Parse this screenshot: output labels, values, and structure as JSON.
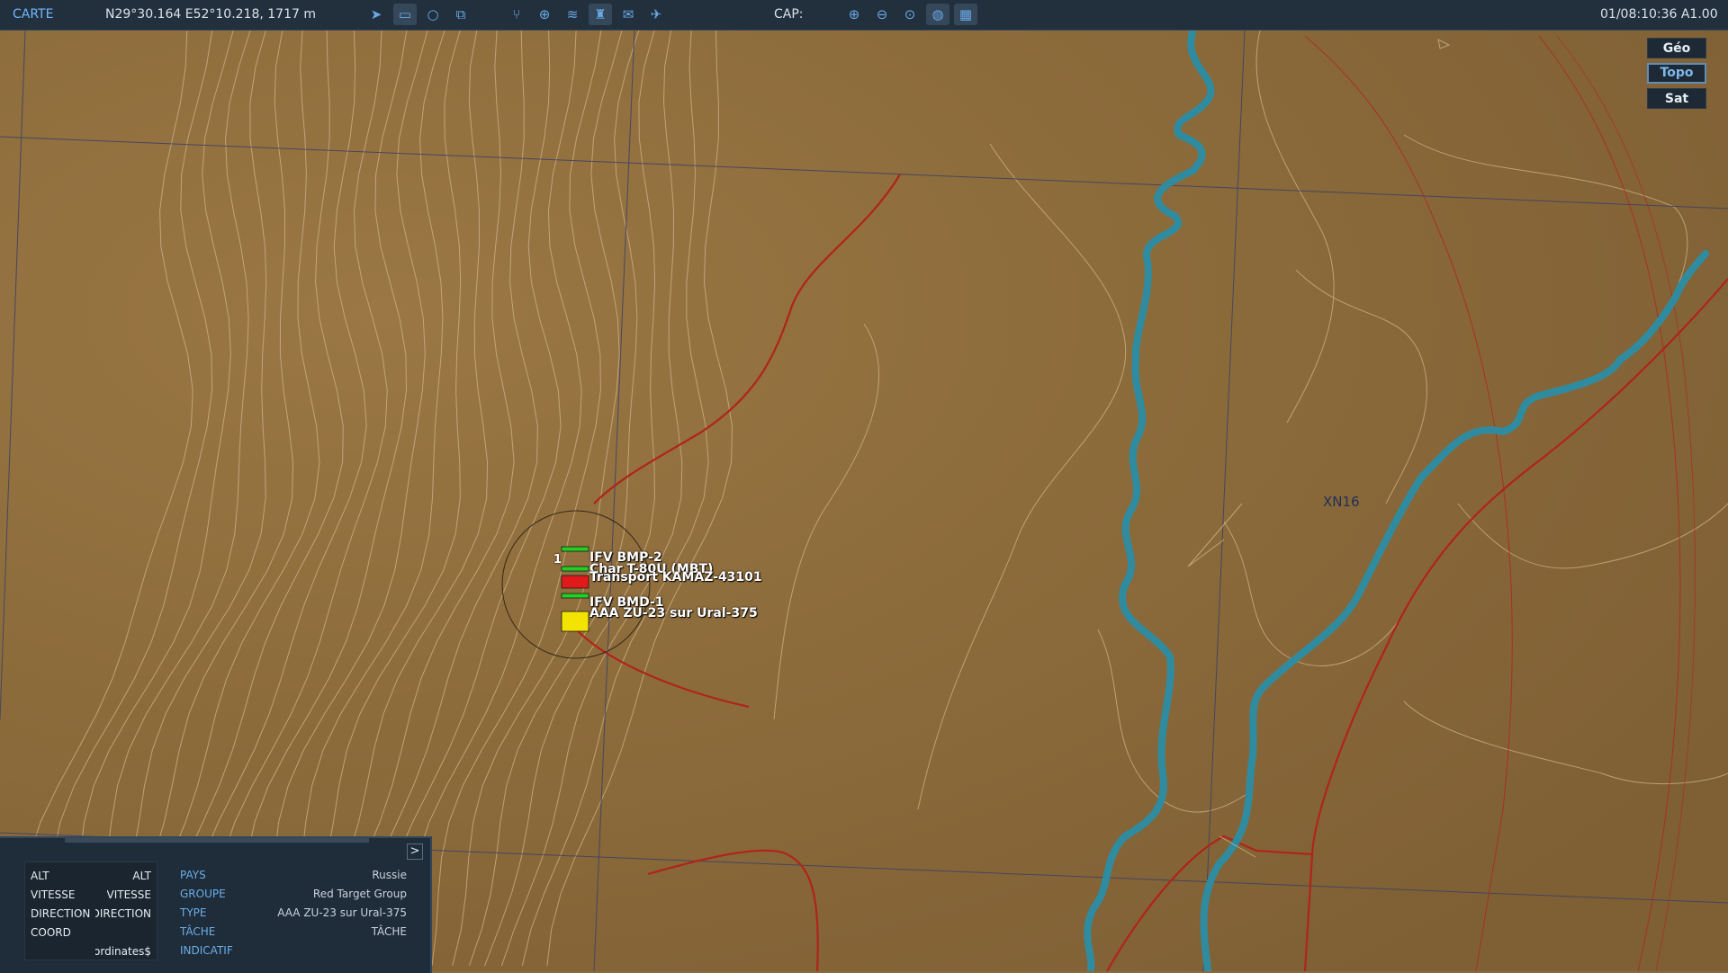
{
  "topbar": {
    "title": "CARTE",
    "coordinates": "N29°30.164 E52°10.218, 1717 m",
    "cap_label": "CAP:",
    "datetime": "01/08:10:36 A1.00",
    "tools_left": [
      {
        "name": "navigate-icon",
        "glyph": "➤"
      },
      {
        "name": "ruler-icon",
        "glyph": "▭"
      },
      {
        "name": "circle-icon",
        "glyph": "○"
      },
      {
        "name": "layers-icon",
        "glyph": "⧉"
      }
    ],
    "tools_mid": [
      {
        "name": "route-icon",
        "glyph": "⑂"
      },
      {
        "name": "crosshair-icon",
        "glyph": "⊕"
      },
      {
        "name": "signal-icon",
        "glyph": "≋"
      },
      {
        "name": "tower-icon",
        "glyph": "♜"
      },
      {
        "name": "chat-icon",
        "glyph": "✉"
      },
      {
        "name": "airfield-icon",
        "glyph": "✈"
      }
    ],
    "tools_right": [
      {
        "name": "zoom-in-icon",
        "glyph": "⊕"
      },
      {
        "name": "zoom-out-icon",
        "glyph": "⊖"
      },
      {
        "name": "zoom-fit-icon",
        "glyph": "⊙"
      },
      {
        "name": "globe-icon",
        "glyph": "◍"
      },
      {
        "name": "grid-icon",
        "glyph": "▦"
      }
    ]
  },
  "map_type": {
    "buttons": [
      "Géo",
      "Topo",
      "Sat"
    ],
    "active": "Topo"
  },
  "map": {
    "grid_label": "XN16",
    "group_number": "1",
    "units": [
      {
        "label": "IFV BMP-2",
        "status_color": "#22d022"
      },
      {
        "label": "Char T-80U (MBT)",
        "status_color": "#22d022"
      },
      {
        "label": "Transport KAMAZ-43101",
        "status_color": "#e01a1a"
      },
      {
        "label": "IFV BMD-1",
        "status_color": "#22d022"
      },
      {
        "label": "AAA ZU-23 sur Ural-375",
        "status_color": "#f2e400"
      }
    ],
    "colors": {
      "terrain": "#8a6a3a",
      "contour": "#cfb48a",
      "road": "#b0241a",
      "river": "#2f8ca0",
      "grid": "#3a3f66"
    }
  },
  "info_panel": {
    "toggle_label": ">",
    "left_rows": [
      {
        "key": "ALT",
        "value": "ALT"
      },
      {
        "key": "VITESSE",
        "value": "VITESSE"
      },
      {
        "key": "DIRECTION",
        "value": "DIRECTION"
      },
      {
        "key": "COORD",
        "value": ""
      },
      {
        "key": "",
        "value": "$coordinates"
      }
    ],
    "right_rows": [
      {
        "key": "PAYS",
        "value": "Russie"
      },
      {
        "key": "GROUPE",
        "value": "Red Target Group"
      },
      {
        "key": "TYPE",
        "value": "AAA ZU-23 sur Ural-375"
      },
      {
        "key": "TÂCHE",
        "value": "TÂCHE"
      },
      {
        "key": "INDICATIF",
        "value": ""
      }
    ]
  }
}
